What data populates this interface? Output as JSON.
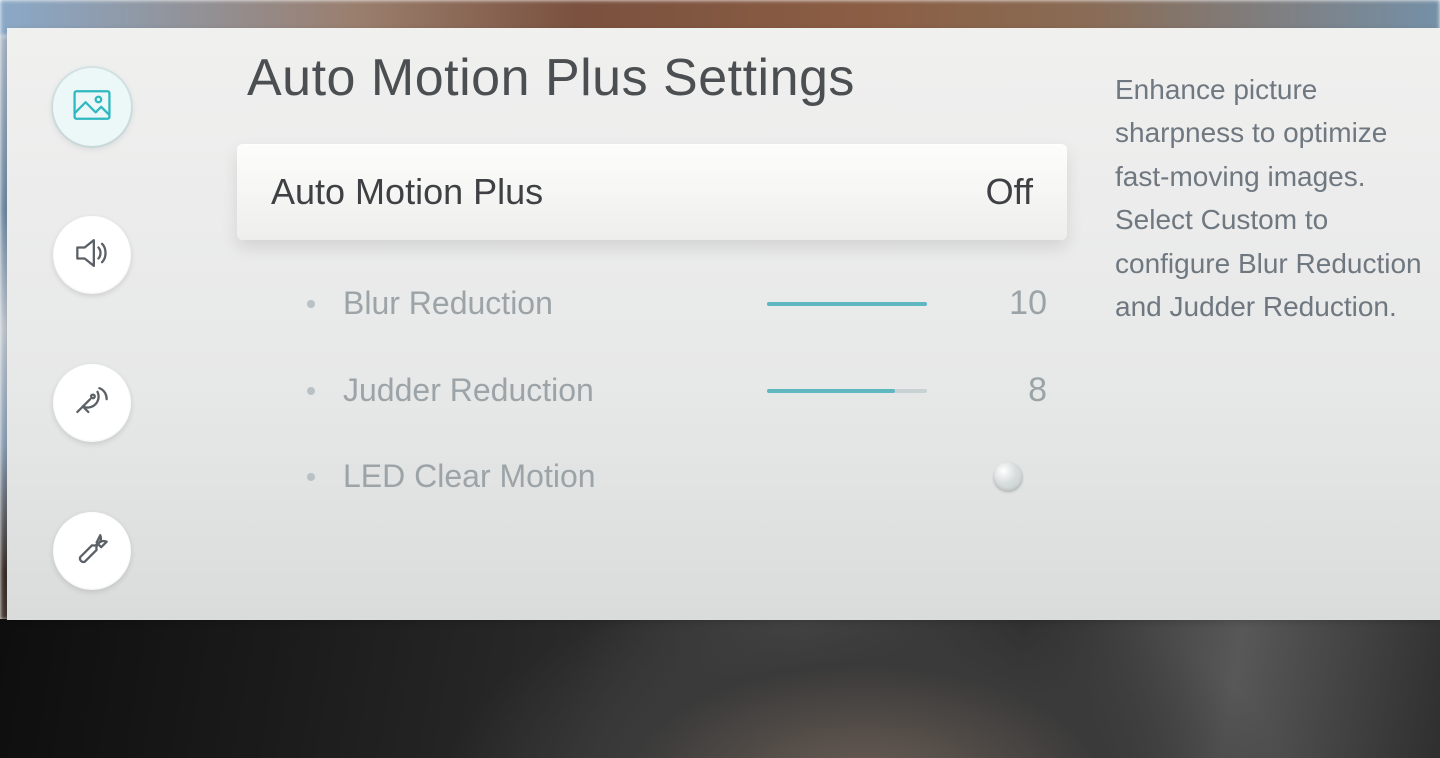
{
  "title": "Auto Motion Plus Settings",
  "description": "Enhance picture sharpness to optimize fast-moving images. Select Custom to configure Blur Reduction and Judder Reduction.",
  "sidebar": {
    "items": [
      {
        "name": "picture",
        "active": true
      },
      {
        "name": "sound",
        "active": false
      },
      {
        "name": "broadcast",
        "active": false
      },
      {
        "name": "general",
        "active": false
      }
    ]
  },
  "main_item": {
    "label": "Auto Motion Plus",
    "value": "Off"
  },
  "sub_items": [
    {
      "label": "Blur Reduction",
      "type": "slider",
      "value": "10",
      "max": 10,
      "num": 10
    },
    {
      "label": "Judder Reduction",
      "type": "slider",
      "value": "8",
      "max": 10,
      "num": 8
    },
    {
      "label": "LED Clear Motion",
      "type": "toggle",
      "state": "off"
    }
  ]
}
